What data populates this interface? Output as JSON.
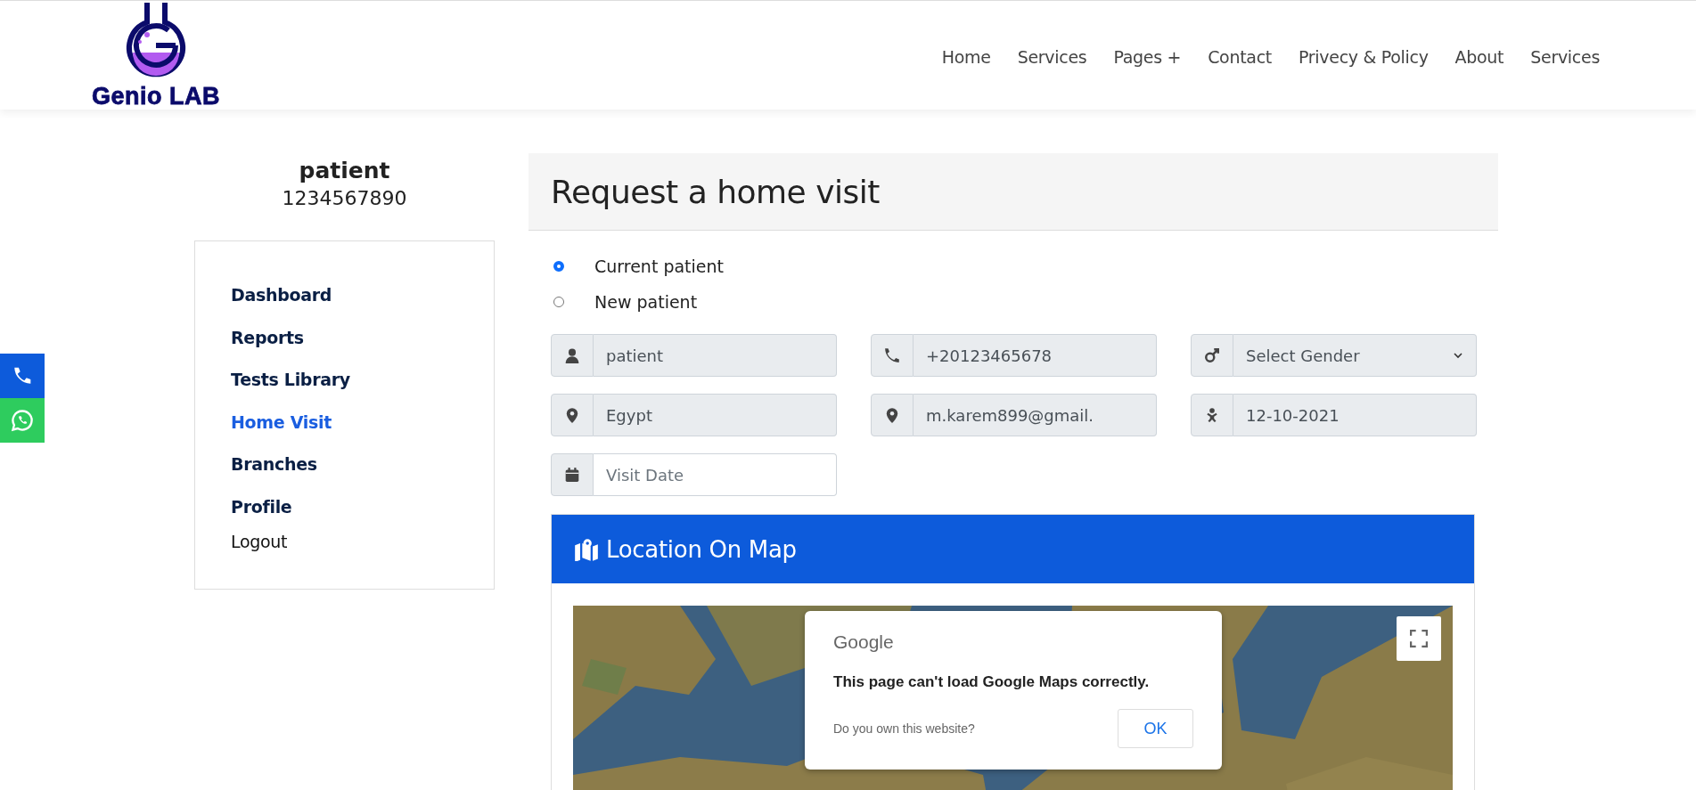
{
  "header": {
    "logo_text": "Genio LAB",
    "nav": [
      {
        "label": "Home"
      },
      {
        "label": "Services"
      },
      {
        "label": "Pages +"
      },
      {
        "label": "Contact"
      },
      {
        "label": "Privecy & Policy"
      },
      {
        "label": "About"
      },
      {
        "label": "Services"
      }
    ]
  },
  "float_buttons": [
    {
      "kind": "phone"
    },
    {
      "kind": "whatsapp"
    }
  ],
  "profile": {
    "name": "patient",
    "phone": "1234567890"
  },
  "sidebar": {
    "items": [
      {
        "label": "Dashboard",
        "kind": "link",
        "selected": false
      },
      {
        "label": "Reports",
        "kind": "link",
        "selected": false
      },
      {
        "label": "Tests Library",
        "kind": "link",
        "selected": false
      },
      {
        "label": "Home Visit",
        "kind": "link",
        "selected": true
      },
      {
        "label": "Branches",
        "kind": "link",
        "selected": false
      },
      {
        "label": "Profile",
        "kind": "link",
        "selected": false
      },
      {
        "label": "Logout",
        "kind": "action",
        "selected": false
      }
    ]
  },
  "form": {
    "title": "Request a home visit",
    "patient_type": [
      {
        "label": "Current patient",
        "selected": true
      },
      {
        "label": "New patient",
        "selected": false
      }
    ],
    "fields": [
      {
        "kind": "person",
        "value": "patient",
        "disabled": true
      },
      {
        "kind": "phone",
        "value": "+20123465678",
        "disabled": true
      },
      {
        "kind": "gender",
        "value": "Select Gender",
        "disabled": true
      },
      {
        "kind": "location",
        "value": "Egypt",
        "disabled": true
      },
      {
        "kind": "location",
        "value": "m.karem899@gmail.",
        "disabled": true
      },
      {
        "kind": "birthday",
        "value": "12-10-2021",
        "disabled": true
      },
      {
        "kind": "date",
        "placeholder": "Visit Date",
        "disabled": false
      }
    ]
  },
  "map_card": {
    "title": "Location On Map",
    "dialog": {
      "brand": "Google",
      "message": "This page can't load Google Maps correctly.",
      "question": "Do you own this website?",
      "button": "OK"
    }
  }
}
